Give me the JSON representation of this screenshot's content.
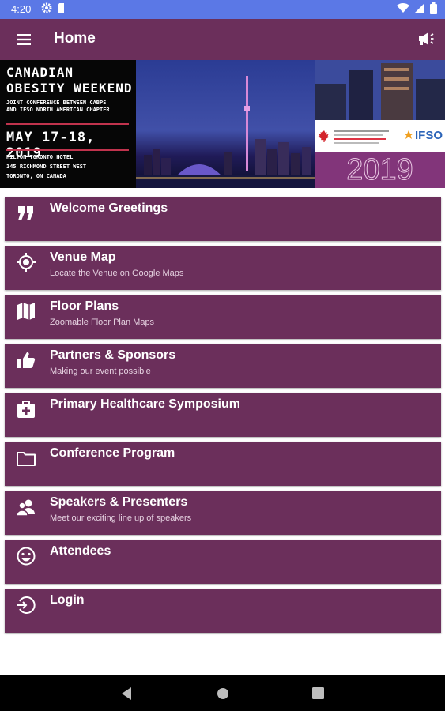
{
  "status_bar": {
    "time": "4:20",
    "left_icons": [
      "settings-icon",
      "sim-card-icon"
    ],
    "right_icons": [
      "wifi-icon",
      "signal-icon",
      "battery-icon"
    ]
  },
  "app_bar": {
    "title": "Home",
    "color": "#6b2f5b"
  },
  "banner": {
    "title_line1": "CANADIAN",
    "title_line2": "OBESITY WEEKEND",
    "subtitle_line1": "JOINT CONFERENCE BETWEEN CABPS",
    "subtitle_line2": "AND IFSO NORTH AMERICAN CHAPTER",
    "dates": "MAY 17-18, 2019",
    "venue_line1": "HILTON TORONTO HOTEL",
    "venue_line2": "145 RICHMOND STREET WEST",
    "venue_line3": "TORONTO, ON CANADA",
    "logo_text": "IFSO",
    "year": "2019"
  },
  "menu": [
    {
      "title": "Welcome Greetings",
      "subtitle": "",
      "icon": "quote-icon"
    },
    {
      "title": "Venue Map",
      "subtitle": "Locate the Venue on Google Maps",
      "icon": "location-target-icon"
    },
    {
      "title": "Floor Plans",
      "subtitle": "Zoomable Floor Plan Maps",
      "icon": "map-icon"
    },
    {
      "title": "Partners & Sponsors",
      "subtitle": "Making our event possible",
      "icon": "thumbs-up-icon"
    },
    {
      "title": "Primary Healthcare Symposium",
      "subtitle": "",
      "icon": "medical-kit-icon"
    },
    {
      "title": "Conference Program",
      "subtitle": "",
      "icon": "folder-icon"
    },
    {
      "title": "Speakers & Presenters",
      "subtitle": "Meet our exciting line up of speakers",
      "icon": "people-icon"
    },
    {
      "title": "Attendees",
      "subtitle": "",
      "icon": "smiley-icon"
    },
    {
      "title": "Login",
      "subtitle": "",
      "icon": "login-icon"
    }
  ],
  "nav_bar": {
    "buttons": [
      "back-icon",
      "home-icon",
      "recents-icon"
    ]
  }
}
